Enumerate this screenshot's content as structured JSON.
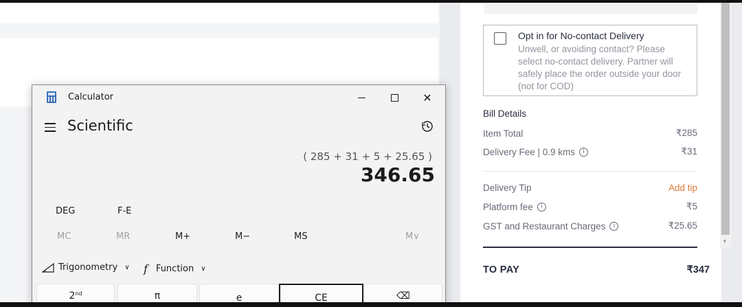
{
  "checkout": {
    "no_contact": {
      "title": "Opt in for No-contact Delivery",
      "description": "Unwell, or avoiding contact? Please select no-contact delivery. Partner will safely place the order outside your door (not for COD)"
    },
    "bill": {
      "title": "Bill Details",
      "item_total_label": "Item Total",
      "item_total_value": "₹285",
      "delivery_fee_label": "Delivery Fee | 0.9 kms",
      "delivery_fee_value": "₹31",
      "delivery_tip_label": "Delivery Tip",
      "delivery_tip_value": "Add tip",
      "platform_fee_label": "Platform fee",
      "platform_fee_value": "₹5",
      "gst_label": "GST and Restaurant Charges",
      "gst_value": "₹25.65"
    },
    "to_pay_label": "TO PAY",
    "to_pay_value": "₹347"
  },
  "calculator": {
    "window_title": "Calculator",
    "mode_title": "Scientific",
    "expression": "( 285 + 31 + 5 + 25.65 )",
    "result": "346.65",
    "angle_mode": "DEG",
    "fe_label": "F-E",
    "memory": [
      "MC",
      "MR",
      "M+",
      "M−",
      "MS",
      "M∨"
    ],
    "trig_label": "Trigonometry",
    "function_label": "Function",
    "function_symbol": "f",
    "keys": {
      "second": "2",
      "second_sup": "nd",
      "pi": "π",
      "e": "e",
      "ce": "CE",
      "backspace": "⌫"
    }
  },
  "colors": {
    "accent_orange": "#db7c38",
    "text_dark": "#282c3f",
    "text_muted": "#686b78"
  }
}
